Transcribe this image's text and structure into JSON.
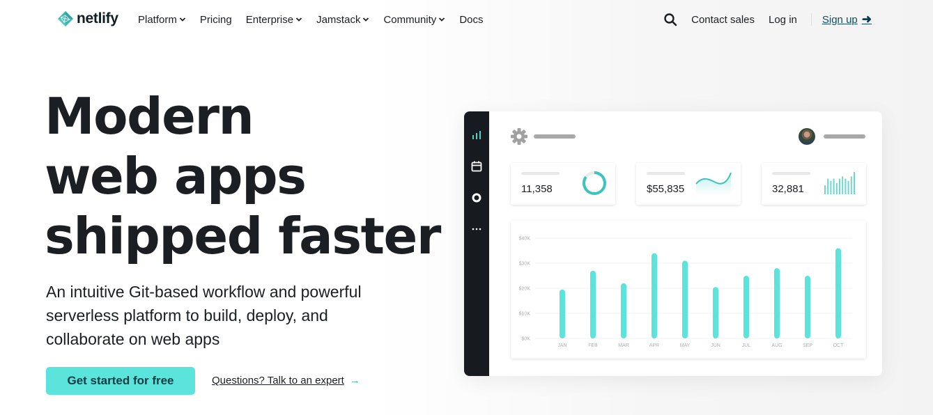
{
  "brand": {
    "name": "netlify",
    "accent": "#5ae4db",
    "dark": "#171b1f"
  },
  "nav": {
    "items": [
      {
        "label": "Platform",
        "dropdown": true
      },
      {
        "label": "Pricing",
        "dropdown": false
      },
      {
        "label": "Enterprise",
        "dropdown": true
      },
      {
        "label": "Jamstack",
        "dropdown": true
      },
      {
        "label": "Community",
        "dropdown": true
      },
      {
        "label": "Docs",
        "dropdown": false
      }
    ],
    "search_icon": "search-icon",
    "contact_sales": "Contact sales",
    "log_in": "Log in",
    "sign_up": "Sign up",
    "sign_up_arrow": "➜"
  },
  "hero": {
    "title_lines": [
      "Modern",
      "web apps",
      "shipped faster"
    ],
    "subtitle": "An intuitive Git-based workflow and powerful serverless platform to build, deploy, and collaborate on web apps",
    "cta_label": "Get started for free",
    "expert_link": "Questions? Talk to an expert",
    "expert_arrow": "→"
  },
  "dashboard": {
    "sidebar_icons": [
      "bar-chart-icon",
      "calendar-icon",
      "lifebuoy-icon",
      "more-dots-icon"
    ],
    "stats": [
      {
        "value": "11,358",
        "visual": "donut",
        "progress": 0.85
      },
      {
        "value": "$55,835",
        "visual": "sparkline"
      },
      {
        "value": "32,881",
        "visual": "mini-bars",
        "bars": [
          4,
          7,
          6,
          7,
          5,
          7,
          8,
          7,
          6,
          8,
          10
        ]
      }
    ]
  },
  "chart_data": {
    "type": "bar",
    "title": "",
    "xlabel": "",
    "ylabel": "",
    "categories": [
      "JAN",
      "FEB",
      "MAR",
      "APR",
      "MAY",
      "JUN",
      "JUL",
      "AUG",
      "SEP",
      "OCT"
    ],
    "values": [
      19500,
      27000,
      22000,
      34000,
      31000,
      20500,
      25000,
      28000,
      25000,
      36000
    ],
    "y_ticks": [
      "$0K",
      "$10K",
      "$20K",
      "$30K",
      "$40K"
    ],
    "ylim": [
      0,
      40000
    ],
    "grid": true,
    "color": "#5ae4db"
  }
}
